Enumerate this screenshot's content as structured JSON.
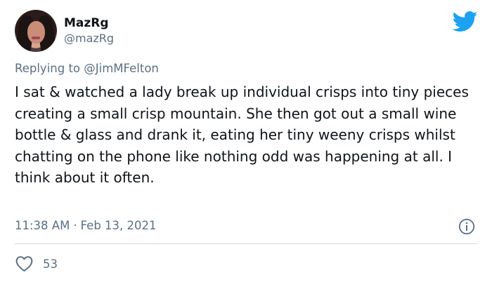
{
  "author": {
    "name": "MazRg",
    "handle": "@mazRg"
  },
  "reply": {
    "prefix": "Replying to ",
    "mention": "@JimMFelton"
  },
  "tweet": {
    "text": "I sat & watched a lady break up individual crisps into tiny pieces creating a small crisp mountain. She then got out a small wine bottle & glass and drank it, eating her tiny weeny crisps whilst chatting on the phone like nothing odd was happening at all. I think about it often.",
    "time": "11:38 AM",
    "separator": "·",
    "date": "Feb 13, 2021"
  },
  "stats": {
    "likes": "53"
  },
  "icons": {
    "brand": "twitter-bird-icon",
    "info": "info-icon",
    "like": "heart-icon"
  },
  "colors": {
    "brand": "#1da1f2",
    "text": "#0f1419",
    "secondary": "#5b7083",
    "divider": "#cfd9de"
  }
}
